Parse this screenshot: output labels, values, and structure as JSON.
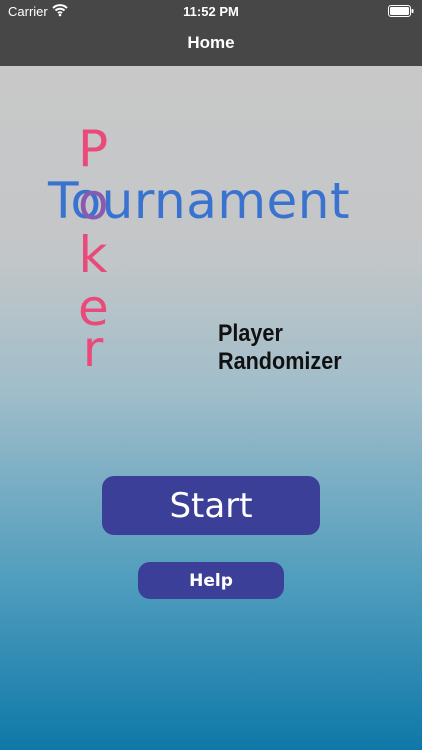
{
  "status_bar": {
    "carrier": "Carrier",
    "time": "11:52 PM",
    "wifi_icon": "wifi-icon",
    "battery_icon": "battery-icon"
  },
  "nav": {
    "title": "Home"
  },
  "logo": {
    "horizontal_word": "Tournament",
    "vertical_letters": [
      "P",
      "o",
      "k",
      "e",
      "r"
    ],
    "colors": {
      "horizontal": "#3a73cf",
      "vertical": "#e94a7a",
      "overlap": "#8a5ab0"
    }
  },
  "subtitle": "Player Randomizer",
  "buttons": {
    "start_label": "Start",
    "help_label": "Help"
  },
  "colors": {
    "bar": "#474747",
    "button": "#3c3f97",
    "gradient_top": "#c8c8c8",
    "gradient_bottom": "#0e78a8"
  }
}
